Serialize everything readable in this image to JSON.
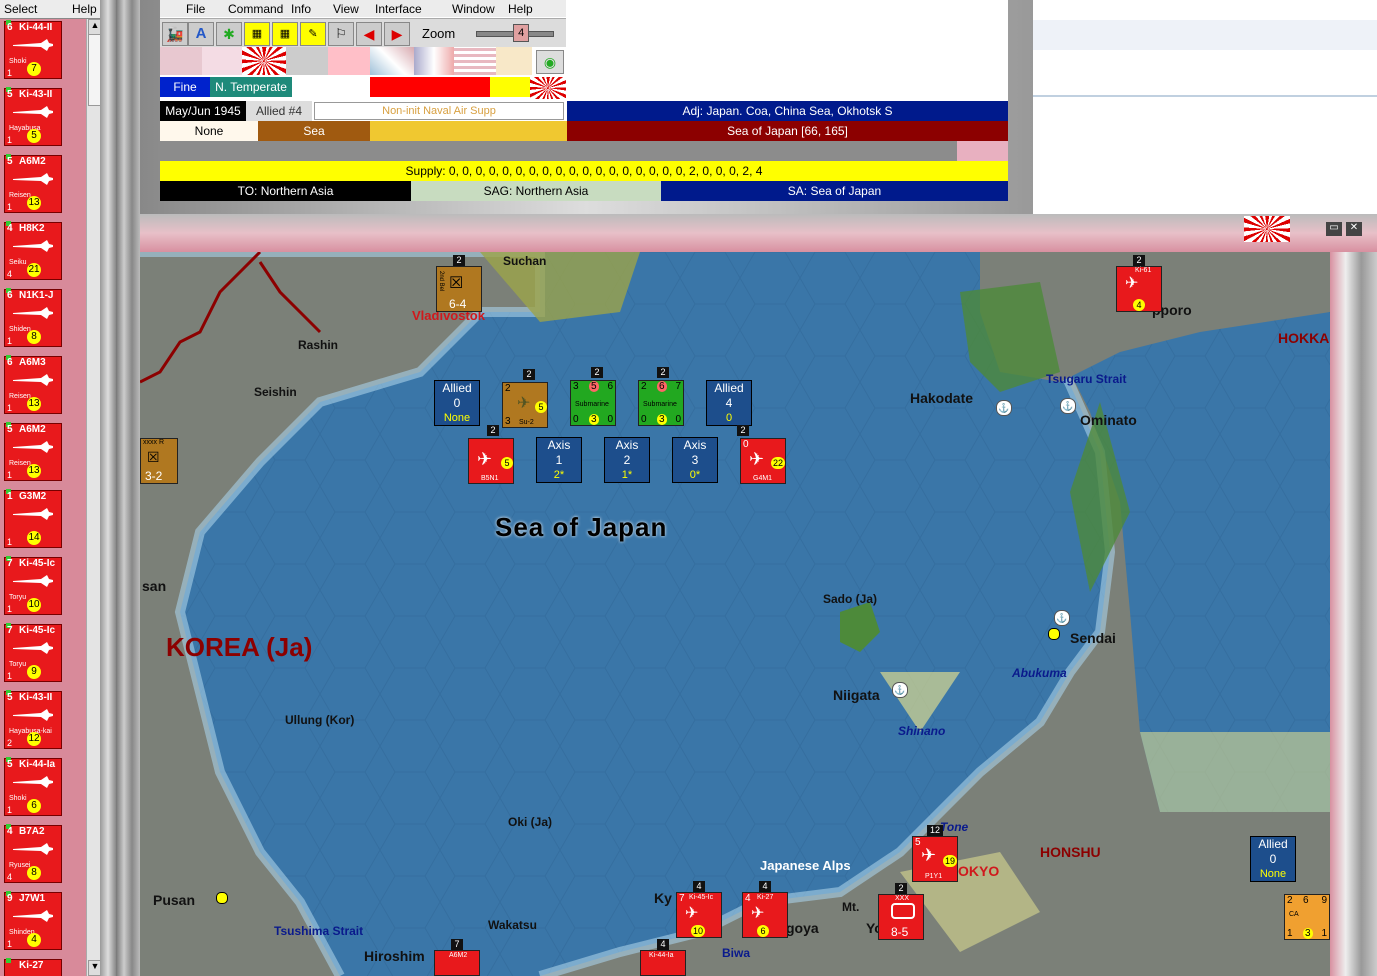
{
  "left_menu": {
    "select": "Select",
    "help": "Help"
  },
  "left_units": [
    {
      "name": "Ki-44-II",
      "sub": "Shoki",
      "num": "1",
      "badge": "7",
      "top_num": "6"
    },
    {
      "name": "Ki-43-II",
      "sub": "Hayabusa",
      "num": "1",
      "badge": "5",
      "top_num": "5"
    },
    {
      "name": "A6M2",
      "sub": "Reisen",
      "num": "1",
      "badge": "13",
      "top_num": "5"
    },
    {
      "name": "H8K2",
      "sub": "Seiku",
      "num": "4",
      "badge": "21",
      "top_num": "4"
    },
    {
      "name": "N1K1-J",
      "sub": "Shiden",
      "num": "1",
      "badge": "8",
      "top_num": "6"
    },
    {
      "name": "A6M3",
      "sub": "Reisen",
      "num": "1",
      "badge": "13",
      "top_num": "6"
    },
    {
      "name": "A6M2",
      "sub": "Reisen",
      "num": "1",
      "badge": "13",
      "top_num": "5"
    },
    {
      "name": "G3M2",
      "sub": "",
      "num": "1",
      "badge": "14",
      "top_num": "1"
    },
    {
      "name": "Ki-45-Ic",
      "sub": "Toryu",
      "num": "1",
      "badge": "10",
      "top_num": "7"
    },
    {
      "name": "Ki-45-Ic",
      "sub": "Toryu",
      "num": "1",
      "badge": "9",
      "top_num": "7"
    },
    {
      "name": "Ki-43-II",
      "sub": "Hayabusa-kai",
      "num": "2",
      "badge": "12",
      "top_num": "5"
    },
    {
      "name": "Ki-44-Ia",
      "sub": "Shoki",
      "num": "1",
      "badge": "6",
      "top_num": "5"
    },
    {
      "name": "B7A2",
      "sub": "Ryusei",
      "num": "4",
      "badge": "8",
      "top_num": "4"
    },
    {
      "name": "J7W1",
      "sub": "Shinden",
      "num": "1",
      "badge": "4",
      "top_num": "9"
    },
    {
      "name": "Ki-27",
      "sub": "",
      "num": "",
      "badge": "",
      "top_num": ""
    }
  ],
  "menu": [
    "File",
    "Command",
    "Info",
    "View",
    "Interface",
    "Window",
    "Help"
  ],
  "zoom": {
    "label": "Zoom",
    "value": "4",
    "level": 0.6
  },
  "info": {
    "weather": "Fine",
    "zone": "N. Temperate",
    "date": "May/Jun 1945",
    "impulse": "Allied #4",
    "mission": "Non-init Naval Air Supp",
    "adjacent": "Adj: Japan. Coa, China Sea, Okhotsk S",
    "terrain_a": "None",
    "terrain_b": "Sea",
    "hex": "Sea of Japan [66, 165]",
    "supply": "Supply: 0, 0, 0, 0, 0, 0, 0, 0, 0, 0, 0, 0, 0, 0, 0, 0, 0, 0, 2, 0, 0, 0, 2, 4",
    "to": "TO: Northern Asia",
    "sag": "SAG: Northern Asia",
    "sa": "SA: Sea of Japan"
  },
  "colors": {
    "red": "#e8191c",
    "navy": "#001a8c",
    "gold": "#f0c830",
    "dark_red": "#8c0000",
    "yellow": "#ffff00",
    "sea": "#3a76a8"
  },
  "map_labels": {
    "sea": "Sea of Japan",
    "korea": "KOREA (Ja)",
    "honshu": "HONSHU",
    "hokkaido": "HOKKA",
    "suchan": "Suchan",
    "vladivostok": "Vladivostok",
    "rashin": "Rashin",
    "seishin": "Seishin",
    "hakodate": "Hakodate",
    "ominato": "Ominato",
    "tsugaru": "Tsugaru Strait",
    "sapporo": "pporo",
    "sado": "Sado (Ja)",
    "sendai": "Sendai",
    "abukuma": "Abukuma",
    "niigata": "Niigata",
    "shinano": "Shinano",
    "ullung": "Ullung (Kor)",
    "oki": "Oki (Ja)",
    "san": "san",
    "pusan": "Pusan",
    "tsushima": "Tsushima Strait",
    "wakatsu": "Wakatsu",
    "hiroshima": "Hiroshim",
    "alps": "Japanese Alps",
    "tone": "Tone",
    "tokyo": "OKYO",
    "goya": "goya",
    "yoko": "Yoko",
    "mt": "Mt.",
    "biwa": "Biwa",
    "ky": "Ky"
  },
  "naval_boxes": [
    {
      "side": "Allied",
      "value": "0",
      "level": "None"
    },
    {
      "side": "Allied",
      "value": "4",
      "level": "0"
    },
    {
      "side": "Axis",
      "value": "1",
      "level": "2*"
    },
    {
      "side": "Axis",
      "value": "2",
      "level": "1*"
    },
    {
      "side": "Axis",
      "value": "3",
      "level": "0*"
    },
    {
      "side": "Allied",
      "value": "0",
      "level": "None"
    }
  ],
  "map_units": {
    "su2": {
      "name": "Su-2",
      "a": "2",
      "b": "3",
      "badge": "5",
      "stack": "2"
    },
    "sub1": {
      "name": "Submarine",
      "a": "3",
      "b": "5",
      "c": "6",
      "d": "0",
      "e": "3",
      "f": "0",
      "stack": "2"
    },
    "sub2": {
      "name": "Submarine",
      "a": "2",
      "b": "6",
      "c": "7",
      "d": "0",
      "e": "3",
      "f": "0",
      "stack": "2"
    },
    "b5n1": {
      "name": "B5N1",
      "badge": "5",
      "stack": "2"
    },
    "g4m1": {
      "name": "G4M1",
      "badge": "22",
      "stack": "2",
      "a": "0"
    },
    "army64": {
      "name": "2nd Bel",
      "value": "6-4",
      "stack": "2"
    },
    "army32": {
      "name": "xxxx R",
      "value": "3-2"
    },
    "ki61": {
      "name": "Ki-61",
      "badge": "4",
      "stack": "2"
    },
    "p1y1": {
      "name": "P1Y1",
      "badge": "19",
      "stack": "12",
      "top": "5"
    },
    "ki45": {
      "name": "Ki-45-Ic",
      "badge": "10",
      "stack": "4",
      "top": "7"
    },
    "ki27": {
      "name": "Ki-27",
      "badge": "6",
      "stack": "4",
      "top": "4"
    },
    "army85": {
      "name": "XXX",
      "value": "8-5",
      "stack": "2"
    },
    "a6m2": {
      "name": "A6M2",
      "stack": "7"
    },
    "ki44": {
      "name": "Ki-44-Ia",
      "stack": "4"
    },
    "cruiser": {
      "name": "CA",
      "a": "2",
      "b": "6",
      "c": "9",
      "d": "1",
      "e": "3",
      "f": "1"
    }
  }
}
